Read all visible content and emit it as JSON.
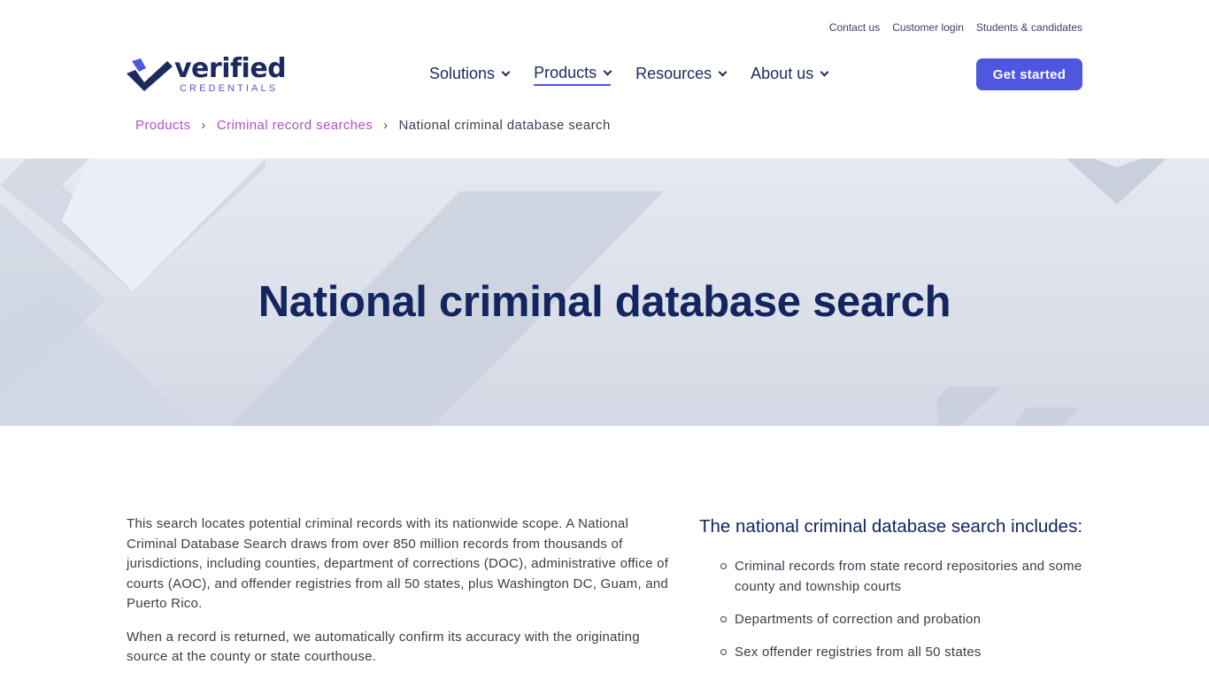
{
  "util_nav": [
    "Contact us",
    "Customer login",
    "Students & candidates"
  ],
  "logo": {
    "word": "verified",
    "sub": "CREDENTIALS"
  },
  "main_nav": [
    {
      "label": "Solutions",
      "active": false
    },
    {
      "label": "Products",
      "active": true
    },
    {
      "label": "Resources",
      "active": false
    },
    {
      "label": "About us",
      "active": false
    }
  ],
  "cta_label": "Get started",
  "breadcrumb": {
    "items": [
      "Products",
      "Criminal record searches"
    ],
    "current": "National criminal database search",
    "separator": "›"
  },
  "hero": {
    "title": "National criminal database search"
  },
  "content": {
    "paragraphs": [
      "This search locates potential criminal records with its nationwide scope. A National Criminal Database Search draws from over 850 million records from thousands of jurisdictions, including counties, department of corrections (DOC), administrative office of courts (AOC), and offender registries from all 50 states, plus Washington DC, Guam, and Puerto Rico.",
      "When a record is returned, we automatically confirm its accuracy with the originating source at the county or state courthouse."
    ],
    "includes_heading": "The national criminal database search includes:",
    "includes": [
      "Criminal records from state record repositories and some county and township courts",
      "Departments of correction and probation",
      "Sex offender registries from all 50 states"
    ]
  },
  "colors": {
    "brand_navy": "#1c2a5e",
    "accent": "#4f56e0",
    "breadcrumb_link": "#b150c8",
    "hero_bg": "#dde1ea"
  }
}
